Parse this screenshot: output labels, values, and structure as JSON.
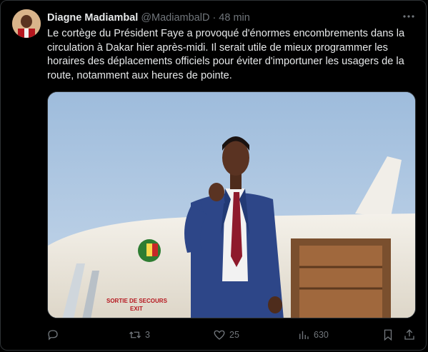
{
  "author": {
    "name": "Diagne Madiambal",
    "handle": "@MadiambalD",
    "separator": "·",
    "time": "48 min"
  },
  "tweet": {
    "text": "Le cortège du Président Faye a provoqué d'énormes encombrements dans la circulation à Dakar hier après-midi.  Il serait utile de mieux programmer les horaires des déplacements officiels pour éviter d'importuner les usagers de la route, notamment aux heures de pointe."
  },
  "media": {
    "aircraft_text": "SORTIE DE SECOURS",
    "aircraft_text_2": "EXIT"
  },
  "actions": {
    "reply_count": "",
    "retweet_count": "3",
    "like_count": "25",
    "views_count": "630"
  },
  "icons": {
    "more": "more-dots-icon",
    "reply": "reply-icon",
    "retweet": "retweet-icon",
    "like": "heart-icon",
    "views": "views-chart-icon",
    "bookmark": "bookmark-icon",
    "share": "share-icon"
  },
  "colors": {
    "background": "#000000",
    "text": "#e7e9ea",
    "muted": "#71767b",
    "border": "#2f3336"
  }
}
